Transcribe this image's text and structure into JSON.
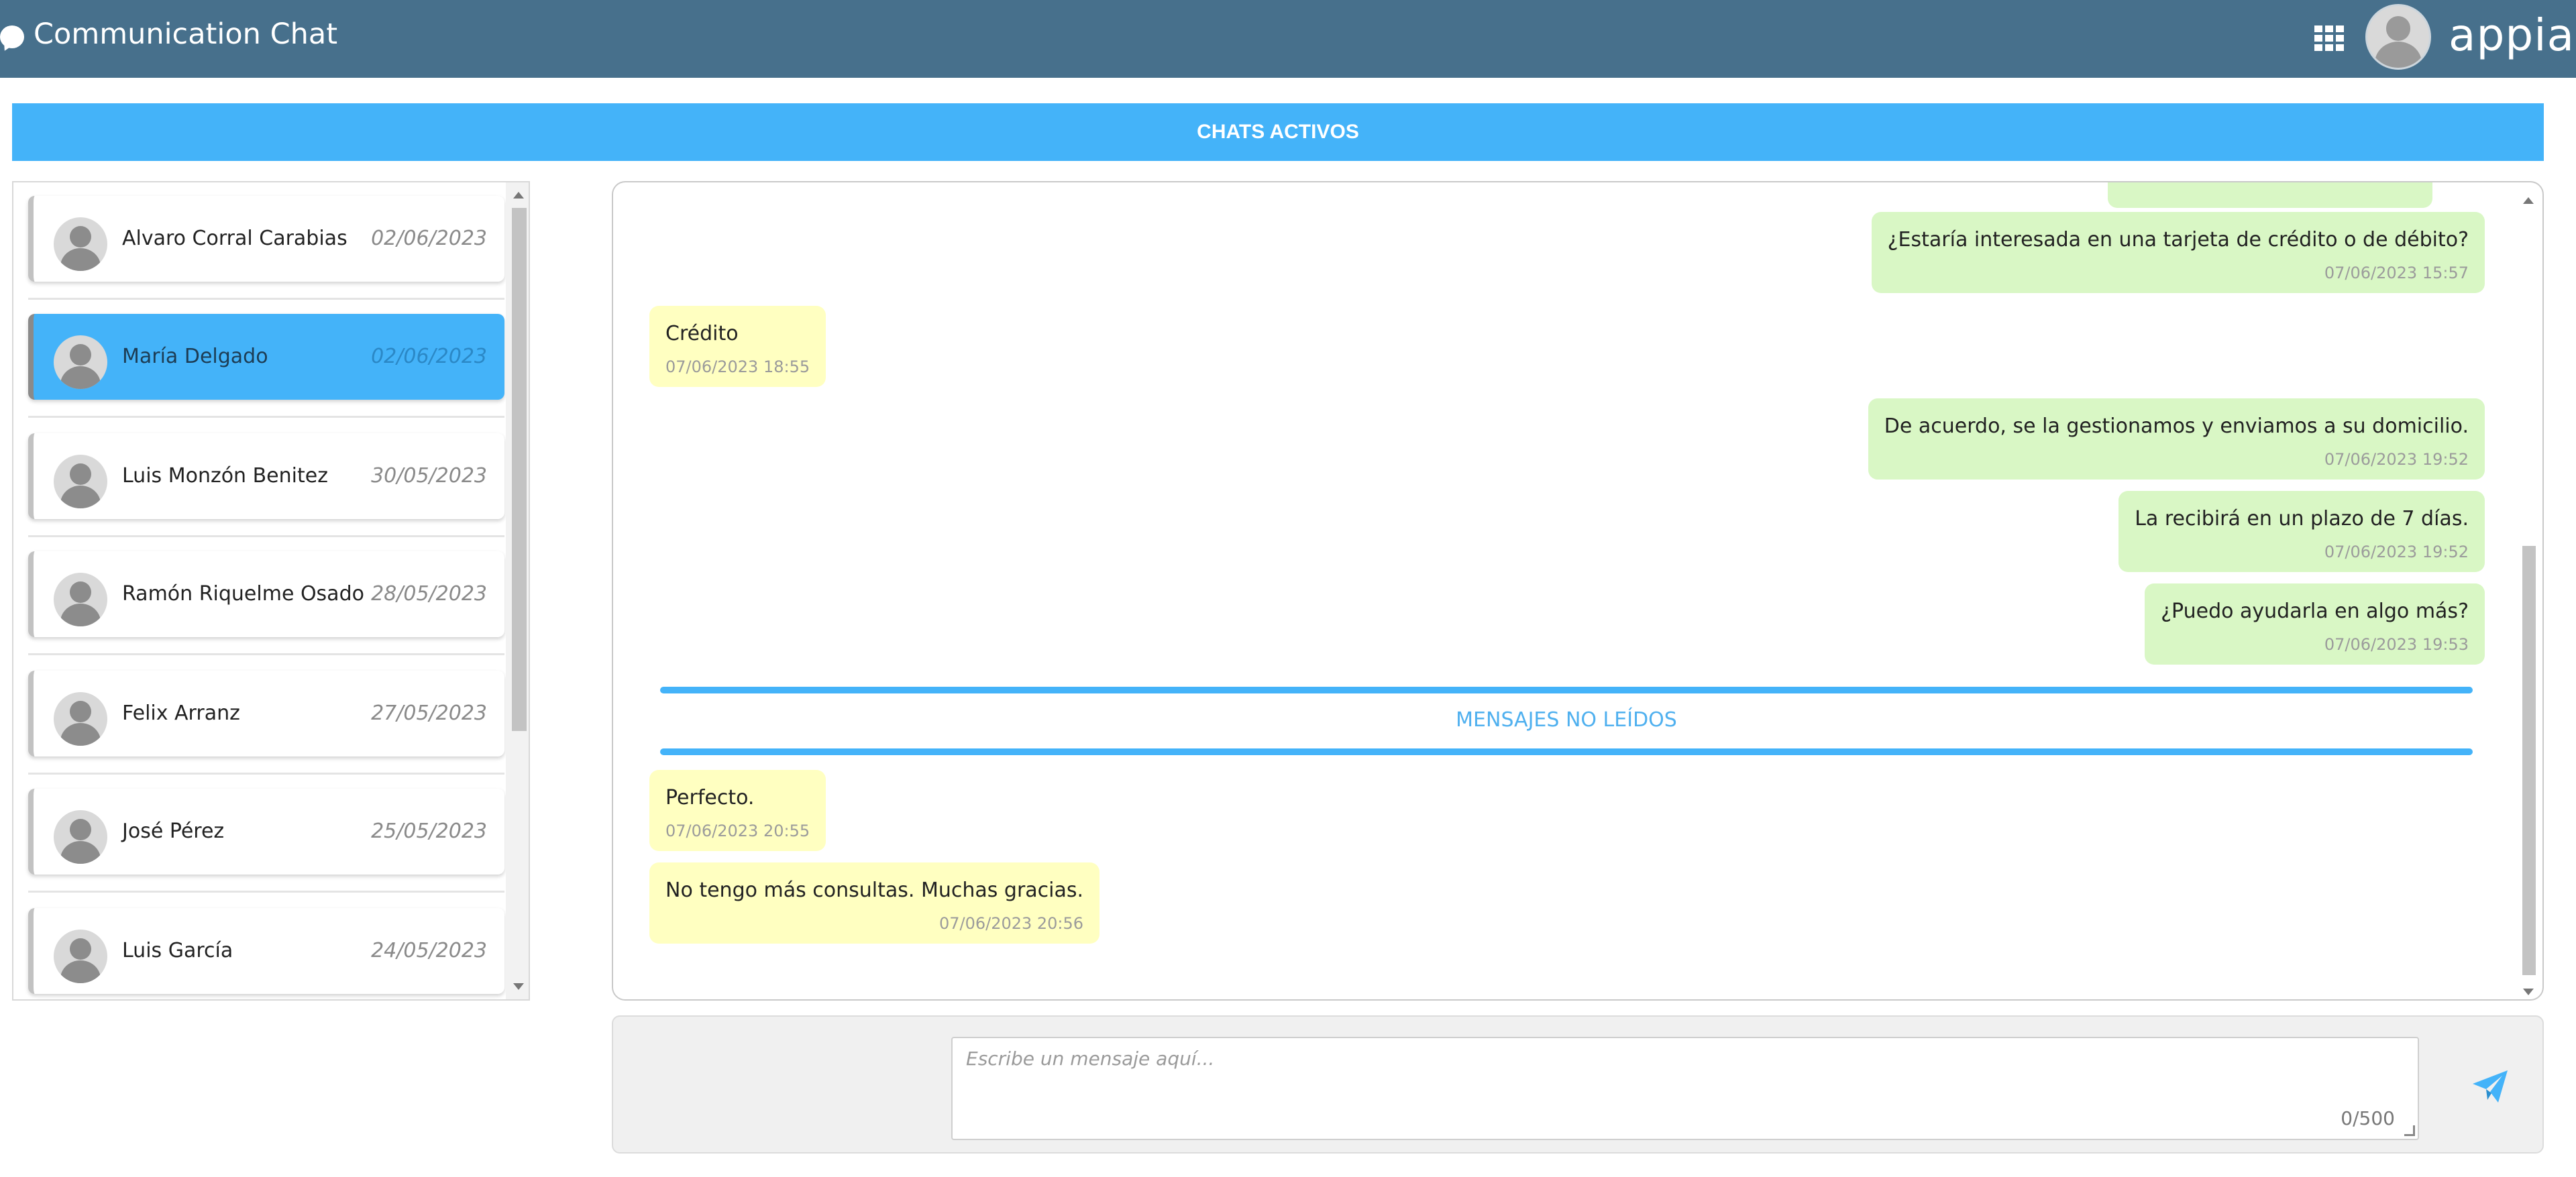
{
  "header": {
    "title": "Communication Chat",
    "brand": "appian",
    "icons": {
      "chat": "chat-bubble-icon",
      "apps": "grid-icon",
      "user": "user-avatar-icon"
    },
    "colors": {
      "bar": "#47708c",
      "accent": "#44b3f9"
    }
  },
  "banner": {
    "title": "CHATS ACTIVOS"
  },
  "conversations": [
    {
      "name": "Alvaro Corral Carabias",
      "date": "02/06/2023",
      "active": false
    },
    {
      "name": "María Delgado",
      "date": "02/06/2023",
      "active": true
    },
    {
      "name": "Luis Monzón Benitez",
      "date": "30/05/2023",
      "active": false
    },
    {
      "name": "Ramón Riquelme Osado",
      "date": "28/05/2023",
      "active": false
    },
    {
      "name": "Felix Arranz",
      "date": "27/05/2023",
      "active": false
    },
    {
      "name": "José Pérez",
      "date": "25/05/2023",
      "active": false
    },
    {
      "name": "Luis García",
      "date": "24/05/2023",
      "active": false
    }
  ],
  "messages": [
    {
      "direction": "out",
      "text": "¿Estaría interesada en una tarjeta de crédito o de débito?",
      "time": "07/06/2023 15:57"
    },
    {
      "direction": "in",
      "text": "Crédito",
      "time": "07/06/2023 18:55"
    },
    {
      "direction": "out",
      "text": "De acuerdo, se la gestionamos y enviamos a su domicilio.",
      "time": "07/06/2023 19:52"
    },
    {
      "direction": "out",
      "text": "La recibirá en un plazo de 7 días.",
      "time": "07/06/2023 19:52"
    },
    {
      "direction": "out",
      "text": "¿Puedo ayudarla en algo más?",
      "time": "07/06/2023 19:53"
    },
    {
      "direction": "in",
      "text": "Perfecto.",
      "time": "07/06/2023 20:55"
    },
    {
      "direction": "in",
      "text": "No tengo más consultas. Muchas gracias.",
      "time": "07/06/2023 20:56"
    }
  ],
  "unread_divider": {
    "label": "MENSAJES NO LEÍDOS"
  },
  "composer": {
    "placeholder": "Escribe un mensaje aquí...",
    "counter": "0/500",
    "send_icon": "paper-plane-icon"
  }
}
